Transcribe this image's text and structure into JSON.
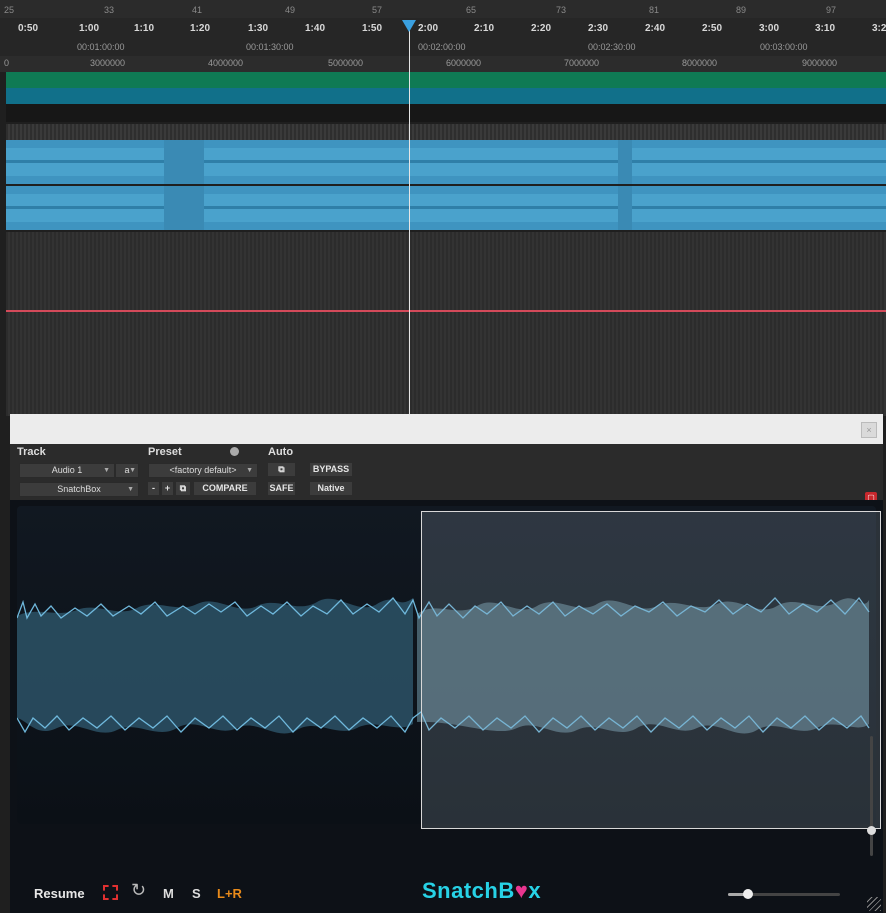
{
  "ruler": {
    "bars": [
      "25",
      "33",
      "41",
      "49",
      "57",
      "65",
      "73",
      "81",
      "89",
      "97"
    ],
    "minsec": [
      "0:50",
      "1:00",
      "1:10",
      "1:20",
      "1:30",
      "1:40",
      "1:50",
      "2:00",
      "2:10",
      "2:20",
      "2:30",
      "2:40",
      "2:50",
      "3:00",
      "3:10",
      "3:2"
    ],
    "timecode": [
      "00:01:00:00",
      "00:01:30:00",
      "00:02:00:00",
      "00:02:30:00",
      "00:03:00:00"
    ],
    "samples": [
      "0",
      "3000000",
      "4000000",
      "5000000",
      "6000000",
      "7000000",
      "8000000",
      "9000000"
    ]
  },
  "plugin": {
    "track_label": "Track",
    "preset_label": "Preset",
    "auto_label": "Auto",
    "track_name": "Audio 1",
    "track_channel": "a",
    "insert_name": "SnatchBox",
    "preset_name": "<factory default>",
    "minus": "-",
    "plus": "+",
    "compare": "COMPARE",
    "bypass": "BYPASS",
    "safe": "SAFE",
    "native": "Native",
    "bottom": {
      "resume": "Resume",
      "m": "M",
      "s": "S",
      "lr": "L+R",
      "logo_pre": "SnatchB",
      "logo_heart": "♥",
      "logo_post": "x"
    }
  },
  "colors": {
    "track_green": "#0f7a54",
    "track_teal": "#11708a",
    "waveform": "#3f94c0",
    "logo": "#27d2e6",
    "lr_accent": "#e88a1a",
    "close_red": "#c8282d"
  }
}
